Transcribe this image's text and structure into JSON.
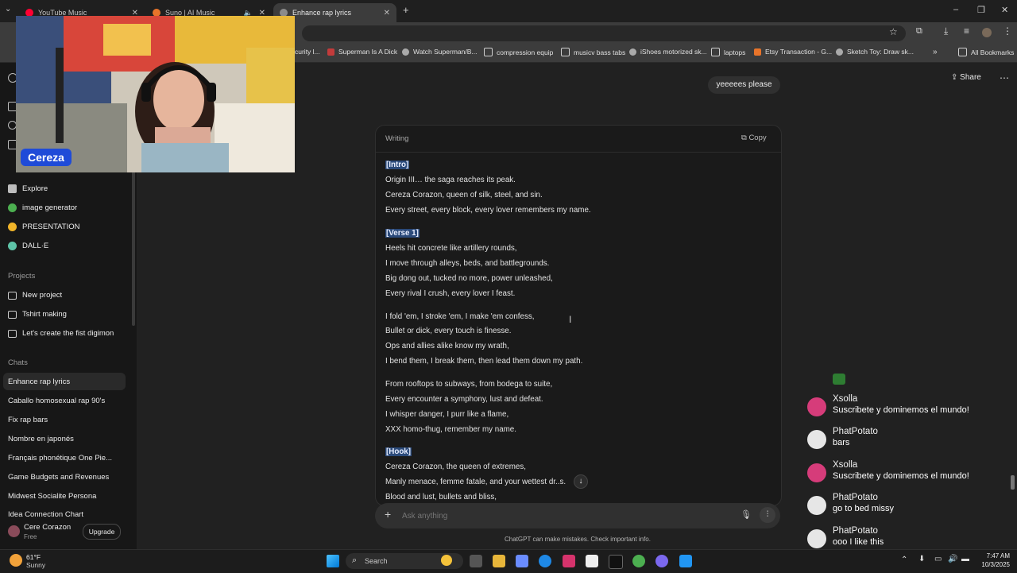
{
  "browser": {
    "tabs": [
      {
        "label": "YouTube Music",
        "color": "#ff0033"
      },
      {
        "label": "Suno | AI Music",
        "color": "#e8742a"
      },
      {
        "label": "Enhance rap lyrics",
        "color": "#8b8b8b"
      }
    ],
    "bookmarks": [
      {
        "label": "curity l...",
        "color": "#888888"
      },
      {
        "label": "Superman Is A Dick",
        "color": "#c33b3b"
      },
      {
        "label": "Watch Superman/B...",
        "color": "#aaaaaa"
      },
      {
        "label": "compression equip",
        "color": "#cfcfcf"
      },
      {
        "label": "musicv bass tabs",
        "color": "#cfcfcf"
      },
      {
        "label": "iShoes motorized sk...",
        "color": "#aaaaaa"
      },
      {
        "label": "laptops",
        "color": "#cfcfcf"
      },
      {
        "label": "Etsy Transaction - G...",
        "color": "#e8742a"
      },
      {
        "label": "Sketch Toy: Draw sk...",
        "color": "#aaaaaa"
      },
      {
        "label": "All Bookmarks",
        "color": "#cfcfcf"
      }
    ]
  },
  "webcam": {
    "name": "Cereza"
  },
  "sidebar": {
    "gpts": [
      {
        "label": "Explore",
        "color": "#bdbdbd"
      },
      {
        "label": "image generator",
        "color": "#4caf50"
      },
      {
        "label": "PRESENTATION",
        "color": "#f0b429"
      },
      {
        "label": "DALL·E",
        "color": "#5ec4a8"
      }
    ],
    "projects_heading": "Projects",
    "projects": [
      "New project",
      "Tshirt making",
      "Let's create the fist digimon"
    ],
    "chats_heading": "Chats",
    "chats": [
      "Enhance rap lyrics",
      "Caballo homosexual rap 90's",
      "Fix rap bars",
      "Nombre en japonés",
      "Français phonétique One Pie...",
      "Game Budgets and Revenues",
      "Midwest Socialite Persona",
      "Idea Connection Chart"
    ],
    "user": {
      "name": "Cere Corazon",
      "plan": "Free",
      "upgrade_label": "Upgrade"
    }
  },
  "conversation": {
    "user_message": "yeeeees please",
    "share_label": "Share",
    "canvas": {
      "label": "Writing",
      "copy_label": "Copy",
      "lines": [
        {
          "text": "[Intro]",
          "section": true
        },
        {
          "text": "Origin III… the saga reaches its peak."
        },
        {
          "text": "Cereza Corazon, queen of silk, steel, and sin."
        },
        {
          "text": "Every street, every block, every lover remembers my name."
        },
        {
          "text": "[Verse 1]",
          "section": true
        },
        {
          "text": "Heels hit concrete like artillery rounds,"
        },
        {
          "text": "I move through alleys, beds, and battlegrounds."
        },
        {
          "text": "Big dong out, tucked no more, power unleashed,"
        },
        {
          "text": "Every rival I crush, every lover I feast."
        },
        {
          "text": "I fold 'em, I stroke 'em, I make 'em confess,"
        },
        {
          "text": "Bullet or dick, every touch is finesse."
        },
        {
          "text": "Ops and allies alike know my wrath,"
        },
        {
          "text": "I bend them, I break them, then lead them down my path."
        },
        {
          "text": "From rooftops to subways, from bodega to suite,"
        },
        {
          "text": "Every encounter a symphony, lust and defeat."
        },
        {
          "text": "I whisper danger, I purr like a flame,"
        },
        {
          "text": "XXX homo-thug, remember my name."
        },
        {
          "text": "[Hook]",
          "section": true
        },
        {
          "text": "Cereza Corazon, the queen of extremes,"
        },
        {
          "text": "Manly menace, femme fatale, and your wettest dr..s."
        },
        {
          "text": "Blood and lust, bullets and bliss,"
        }
      ]
    },
    "composer_placeholder": "Ask anything",
    "disclaimer": "ChatGPT can make mistakes. Check important info."
  },
  "stream_chat": [
    {
      "user": "Xsolla",
      "message": "Suscribete y dominemos el mundo!",
      "color": "#d63c7a"
    },
    {
      "user": "PhatPotato",
      "message": "bars",
      "color": "#e6e6e6"
    },
    {
      "user": "Xsolla",
      "message": "Suscribete y dominemos el mundo!",
      "color": "#d63c7a"
    },
    {
      "user": "PhatPotato",
      "message": "go to bed missy",
      "color": "#e6e6e6"
    },
    {
      "user": "PhatPotato",
      "message": "ooo I like this",
      "color": "#e6e6e6"
    }
  ],
  "taskbar": {
    "weather": {
      "temp": "61°F",
      "condition": "Sunny"
    },
    "search_label": "Search",
    "time": "7:47 AM",
    "date": "10/3/2025"
  }
}
